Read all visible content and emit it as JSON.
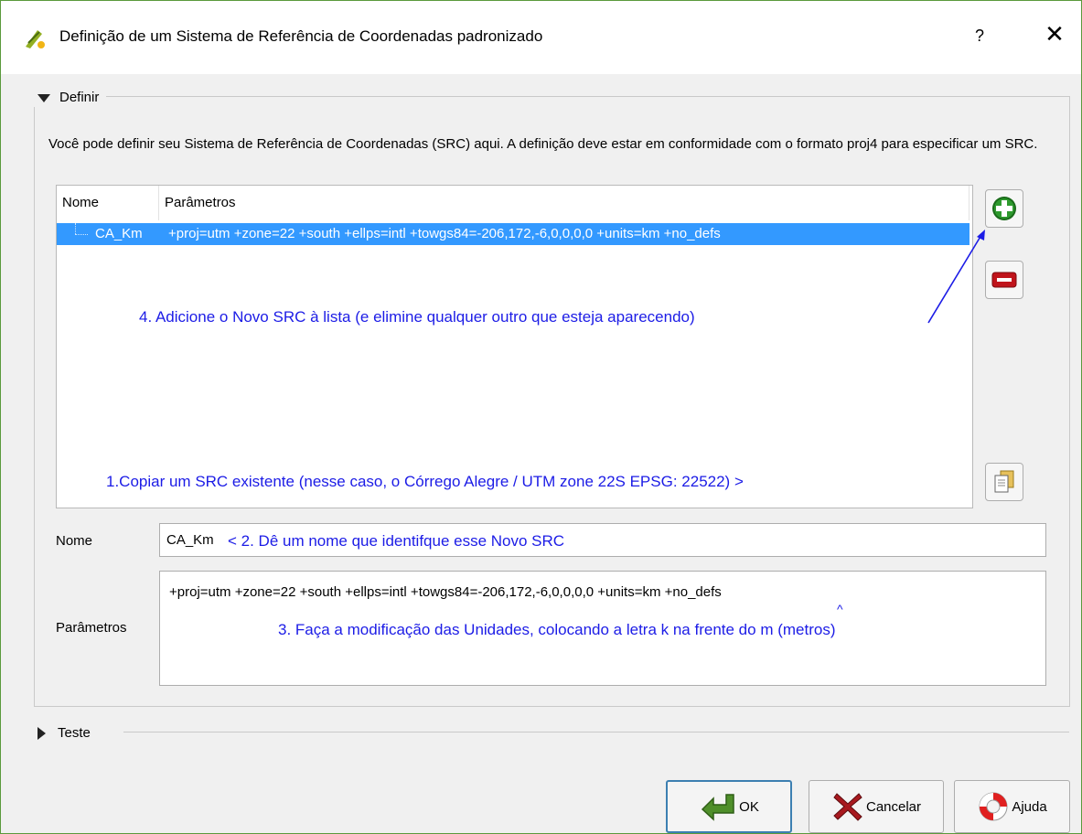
{
  "window": {
    "title": "Definição de um Sistema de Referência de Coordenadas padronizado",
    "help_glyph": "?",
    "close_glyph": "✕"
  },
  "define_group": {
    "title": "Definir",
    "description": "Você pode definir seu Sistema de Referência de Coordenadas (SRC) aqui. A definição deve estar em conformidade com o formato proj4 para especificar um SRC.",
    "table": {
      "headers": [
        "Nome",
        "Parâmetros"
      ],
      "rows": [
        {
          "name": "CA_Km",
          "params": "+proj=utm +zone=22 +south +ellps=intl +towgs84=-206,172,-6,0,0,0,0 +units=km +no_defs"
        }
      ]
    },
    "name_label": "Nome",
    "name_value": "CA_Km",
    "params_label": "Parâmetros",
    "params_value": "+proj=utm +zone=22 +south +ellps=intl +towgs84=-206,172,-6,0,0,0,0 +units=km +no_defs"
  },
  "annotations": {
    "step1": "1.Copiar um SRC existente (nesse caso, o Córrego Alegre / UTM zone 22S EPSG: 22522) >",
    "step2": "< 2. Dê um nome que identifque esse Novo SRC",
    "step3": "3. Faça a modificação das Unidades, colocando a letra k na frente do m (metros)",
    "step3_caret": "^",
    "step4": "4. Adicione o Novo SRC à lista (e elimine qualquer outro que esteja aparecendo)",
    "color": "#1c1ce6"
  },
  "test_group": {
    "title": "Teste"
  },
  "buttons": {
    "ok": "OK",
    "cancel": "Cancelar",
    "help": "Ajuda"
  },
  "icons": {
    "add": "plus-icon",
    "remove": "minus-icon",
    "copy": "copy-icon",
    "app": "qgis-icon"
  },
  "colors": {
    "selection": "#3399ff",
    "add_green": "#2e9a2e",
    "remove_red": "#c0141b"
  }
}
